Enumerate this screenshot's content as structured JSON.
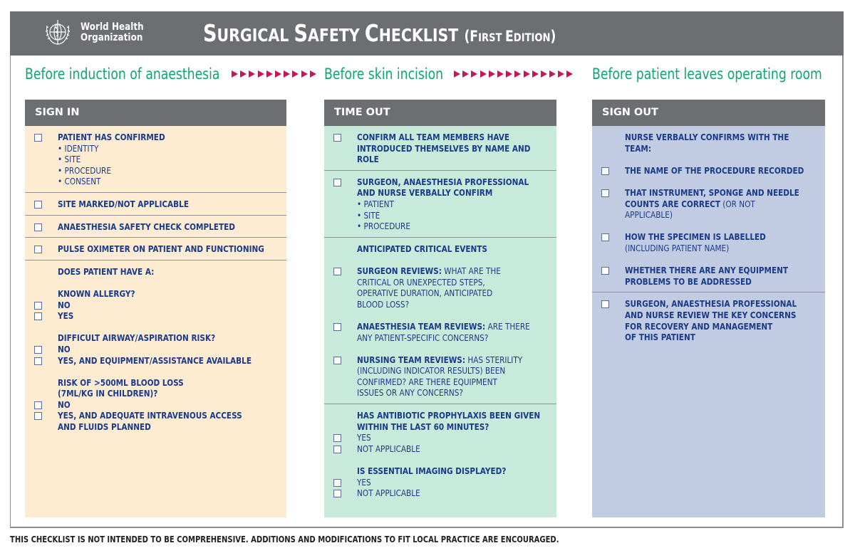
{
  "header": {
    "org_line1": "World Health",
    "org_line2": "Organization",
    "title_S1": "S",
    "title_rest1": "URGICAL ",
    "title_S2": "S",
    "title_rest2": "AFETY ",
    "title_C": "C",
    "title_rest3": "HECKLIST",
    "edition_open": "(F",
    "edition_rest1": "IRST ",
    "edition_E": "E",
    "edition_rest2": "DITION",
    "edition_close": ")",
    "logo_icon": "who-emblem-icon"
  },
  "phases": {
    "phase1": "Before induction of anaesthesia",
    "phase2": "Before skin incision",
    "phase3": "Before patient leaves operating room",
    "arrow_color": "#c2185b",
    "arrows_group1": 10,
    "arrows_group2": 14
  },
  "sign_in": {
    "title": "SIGN IN",
    "s1": [
      "PATIENT HAS CONFIRMED",
      "• IDENTITY",
      "• SITE",
      "• PROCEDURE",
      "• CONSENT"
    ],
    "s2": "SITE MARKED/NOT APPLICABLE",
    "s3": "ANAESTHESIA SAFETY CHECK COMPLETED",
    "s4": "PULSE OXIMETER ON PATIENT AND FUNCTIONING",
    "s5": {
      "intro": "DOES PATIENT HAVE A:",
      "allergy_q": "KNOWN ALLERGY?",
      "allergy_no": "NO",
      "allergy_yes": "YES",
      "airway_q": "DIFFICULT AIRWAY/ASPIRATION RISK?",
      "airway_no": "NO",
      "airway_yes": "YES, AND EQUIPMENT/ASSISTANCE AVAILABLE",
      "blood_q1": "RISK OF >500ML BLOOD LOSS",
      "blood_q2": "(7ML/KG IN CHILDREN)?",
      "blood_no": "NO",
      "blood_yes1": "YES, AND ADEQUATE INTRAVENOUS ACCESS",
      "blood_yes2": "AND FLUIDS PLANNED"
    }
  },
  "time_out": {
    "title": "TIME OUT",
    "s1": [
      "CONFIRM ALL TEAM MEMBERS HAVE",
      "INTRODUCED THEMSELVES BY NAME AND",
      "ROLE"
    ],
    "s2": [
      "SURGEON, ANAESTHESIA PROFESSIONAL",
      "AND NURSE VERBALLY CONFIRM",
      "• PATIENT",
      "• SITE",
      "• PROCEDURE"
    ],
    "s3": {
      "heading": "ANTICIPATED CRITICAL EVENTS",
      "surgeon_lead": "SURGEON REVIEWS:",
      "surgeon_rest": " WHAT ARE THE",
      "surgeon_lines": [
        "CRITICAL OR UNEXPECTED STEPS,",
        "OPERATIVE DURATION, ANTICIPATED",
        "BLOOD LOSS?"
      ],
      "anaes_lead": "ANAESTHESIA TEAM REVIEWS:",
      "anaes_rest": " ARE THERE",
      "anaes_lines": [
        "ANY PATIENT-SPECIFIC CONCERNS?"
      ],
      "nursing_lead": "NURSING TEAM REVIEWS:",
      "nursing_rest": " HAS STERILITY",
      "nursing_lines": [
        "(INCLUDING INDICATOR RESULTS) BEEN",
        "CONFIRMED? ARE THERE EQUIPMENT",
        "ISSUES OR ANY CONCERNS?"
      ]
    },
    "s4": {
      "antibiotic_q1": "HAS ANTIBIOTIC PROPHYLAXIS BEEN GIVEN",
      "antibiotic_q2": "WITHIN THE LAST 60 MINUTES?",
      "antibiotic_yes": "YES",
      "antibiotic_na": "NOT APPLICABLE",
      "imaging_q": "IS ESSENTIAL IMAGING DISPLAYED?",
      "imaging_yes": "YES",
      "imaging_na": "NOT APPLICABLE"
    }
  },
  "sign_out": {
    "title": "SIGN OUT",
    "intro": [
      "NURSE VERBALLY CONFIRMS WITH THE",
      "TEAM:"
    ],
    "procedure": "THE NAME OF THE PROCEDURE RECORDED",
    "counts_l1": "THAT INSTRUMENT, SPONGE AND NEEDLE",
    "counts_l2a": "COUNTS ARE CORRECT",
    "counts_l2b": " (OR NOT",
    "counts_l3": "APPLICABLE)",
    "specimen": [
      "HOW THE SPECIMEN IS LABELLED",
      "(INCLUDING PATIENT NAME)"
    ],
    "equipment": [
      "WHETHER THERE ARE ANY EQUIPMENT",
      "PROBLEMS TO BE ADDRESSED"
    ],
    "review": [
      "SURGEON, ANAESTHESIA PROFESSIONAL",
      "AND NURSE REVIEW THE KEY CONCERNS",
      "FOR RECOVERY AND MANAGEMENT",
      "OF THIS PATIENT"
    ]
  },
  "footer": "THIS CHECKLIST IS NOT INTENDED TO BE COMPREHENSIVE. ADDITIONS AND MODIFICATIONS TO FIT LOCAL PRACTICE ARE ENCOURAGED."
}
